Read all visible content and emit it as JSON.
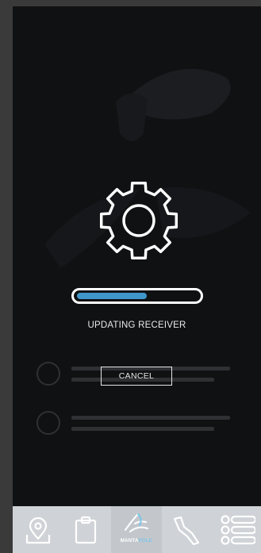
{
  "overlay": {
    "status": "UPDATING RECEIVER",
    "cancel_label": "CANCEL",
    "progress": 0.58
  },
  "tabbar": {
    "items": [
      {
        "name": "map",
        "icon": "map-pin-icon"
      },
      {
        "name": "clipboard",
        "icon": "clipboard-icon"
      },
      {
        "name": "brand",
        "icon": "manta-logo-icon",
        "brand_left": "MANTA",
        "brand_right": "POLE"
      },
      {
        "name": "track",
        "icon": "track-icon"
      },
      {
        "name": "menu",
        "icon": "list-menu-icon"
      }
    ]
  },
  "colors": {
    "progress_fill": "#3f97c9",
    "screen_bg": "#101113",
    "tabbar_bg": "#cfd2d6"
  }
}
